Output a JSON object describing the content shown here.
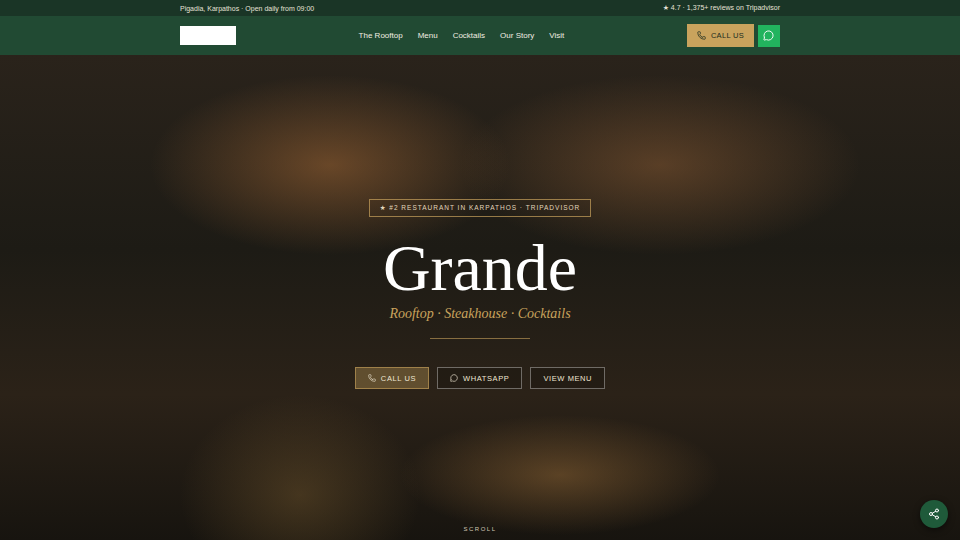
{
  "topbar": {
    "location": "Pigadia, Karpathos · Open daily from 09:00",
    "rating": "★ 4.7 · 1,375+ reviews on Tripadvisor"
  },
  "nav": {
    "links": [
      "The Rooftop",
      "Menu",
      "Cocktails",
      "Our Story",
      "Visit"
    ],
    "call": "CALL US"
  },
  "hero": {
    "badge": "★ #2 RESTAURANT IN KARPATHOS · TRIPADVISOR",
    "title": "Grande",
    "subtitle": "Rooftop · Steakhouse · Cocktails",
    "buttons": [
      {
        "label": "CALL US",
        "kind": "primary"
      },
      {
        "label": "WHATSAPP",
        "kind": "outline"
      },
      {
        "label": "VIEW MENU",
        "kind": "outline"
      }
    ],
    "scroll": "SCROLL"
  }
}
